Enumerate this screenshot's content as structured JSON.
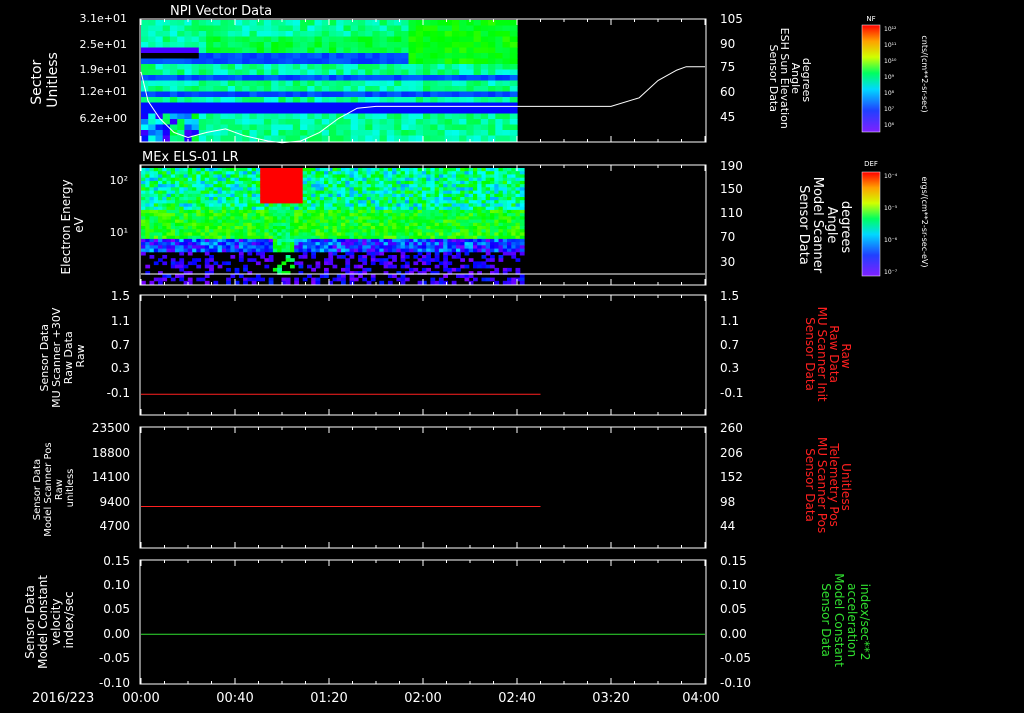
{
  "colors": {
    "background": "#000000",
    "axis": "#ffffff",
    "red_trace": "#ff2020",
    "green_trace": "#30e030"
  },
  "date_label": "2016/223",
  "time_ticks": [
    "00:00",
    "00:40",
    "01:20",
    "02:00",
    "02:40",
    "03:20",
    "04:00"
  ],
  "time_range_minutes": [
    0,
    240
  ],
  "panels": [
    {
      "id": "npi",
      "title": "NPI Vector Data",
      "left_label": [
        "Sector",
        "Unitless"
      ],
      "left_ticks": [
        "3.1e+01",
        "2.5e+01",
        "1.9e+01",
        "1.2e+01",
        "6.2e+00"
      ],
      "right_label": [
        "Sensor Data",
        "ESH Sun Elevation",
        "Angle",
        "degrees"
      ],
      "right_ticks": [
        "105",
        "90",
        "75",
        "60",
        "45"
      ],
      "colorbar_title": "NF",
      "colorbar_units": "cnts/(cm**2-sr-sec)",
      "colorbar_ticks": [
        "10¹²",
        "10¹¹",
        "10¹⁰",
        "10⁹",
        "10⁸",
        "10⁷",
        "10⁶"
      ]
    },
    {
      "id": "els",
      "title": "MEx ELS-01 LR",
      "left_label": [
        "Electron Energy",
        "eV"
      ],
      "left_ticks": [
        "10²",
        "10¹"
      ],
      "right_label": [
        "Sensor Data",
        "Model Scanner",
        "Angle",
        "degrees"
      ],
      "right_ticks": [
        "190",
        "150",
        "110",
        "70",
        "30"
      ],
      "colorbar_title": "DEF",
      "colorbar_units": "ergs/(cm**2-sr-sec-eV)",
      "colorbar_ticks": [
        "10⁻⁴",
        "10⁻⁵",
        "10⁻⁶",
        "10⁻⁷"
      ]
    },
    {
      "id": "raw30",
      "left_label": [
        "Sensor Data",
        "MU Scanner +30V",
        "Raw Data",
        "Raw"
      ],
      "left_ticks": [
        "1.5",
        "1.1",
        "0.7",
        "0.3",
        "-0.1"
      ],
      "right_label": [
        "Sensor Data",
        "MU Scanner Init",
        "Raw Data",
        "Raw"
      ],
      "right_ticks": [
        "1.5",
        "1.1",
        "0.7",
        "0.3",
        "-0.1"
      ]
    },
    {
      "id": "pos",
      "left_label": [
        "Sensor Data",
        "Model Scanner Pos",
        "Raw",
        "unitless"
      ],
      "left_ticks": [
        "23500",
        "18800",
        "14100",
        "9400",
        "4700"
      ],
      "right_label": [
        "Sensor Data",
        "MU Scanner Pos",
        "Telemetry Pos",
        "Unitless"
      ],
      "right_ticks": [
        "260",
        "206",
        "152",
        "98",
        "44"
      ]
    },
    {
      "id": "vel",
      "left_label": [
        "Sensor Data",
        "Model Constant",
        "velocity",
        "index/sec"
      ],
      "left_ticks": [
        "0.15",
        "0.10",
        "0.05",
        "0.00",
        "-0.05",
        "-0.10"
      ],
      "right_label": [
        "Sensor Data",
        "Model Constant",
        "acceleration",
        "index/sec**2"
      ],
      "right_ticks": [
        "0.15",
        "0.10",
        "0.05",
        "0.00",
        "-0.05",
        "-0.10"
      ]
    }
  ],
  "chart_data": [
    {
      "type": "heatmap",
      "title": "NPI Vector Data",
      "ylabel": "Sector Unitless",
      "ylim": [
        6.2,
        31
      ],
      "data_end_minutes": 160,
      "overlay_series": {
        "name": "ESH Sun Elevation Angle",
        "x": [
          0,
          3,
          8,
          14,
          20,
          28,
          36,
          44,
          54,
          60,
          68,
          76,
          84,
          92,
          100,
          120,
          150,
          175,
          200,
          212,
          220,
          228,
          232,
          240
        ],
        "y": [
          75,
          58,
          48,
          40,
          37,
          40,
          42,
          38,
          35,
          34,
          35,
          40,
          48,
          54,
          55,
          55,
          55,
          55,
          55,
          60,
          70,
          76,
          78,
          78
        ],
        "ylim": [
          35,
          105
        ]
      }
    },
    {
      "type": "heatmap",
      "title": "MEx ELS-01 LR",
      "ylabel": "Electron Energy eV",
      "yscale": "log",
      "data_end_minutes": 163,
      "overlay_series": {
        "name": "Model Scanner Angle",
        "x": [
          0,
          240
        ],
        "y": [
          8,
          8
        ],
        "ylim": [
          0,
          190
        ]
      }
    },
    {
      "type": "line",
      "series": [
        {
          "name": "MU Scanner +30V Raw Data",
          "x": [
            0,
            170
          ],
          "y": [
            0,
            0
          ]
        }
      ],
      "ylim": [
        -0.3,
        1.5
      ]
    },
    {
      "type": "line",
      "series": [
        {
          "name": "Model Scanner Pos Raw",
          "x": [
            0,
            170
          ],
          "y": [
            8000,
            8000
          ]
        }
      ],
      "ylim": [
        0,
        23500
      ]
    },
    {
      "type": "line",
      "series": [
        {
          "name": "Model Constant velocity",
          "x": [
            0,
            240
          ],
          "y": [
            0,
            0
          ]
        }
      ],
      "ylim": [
        -0.1,
        0.15
      ]
    }
  ]
}
